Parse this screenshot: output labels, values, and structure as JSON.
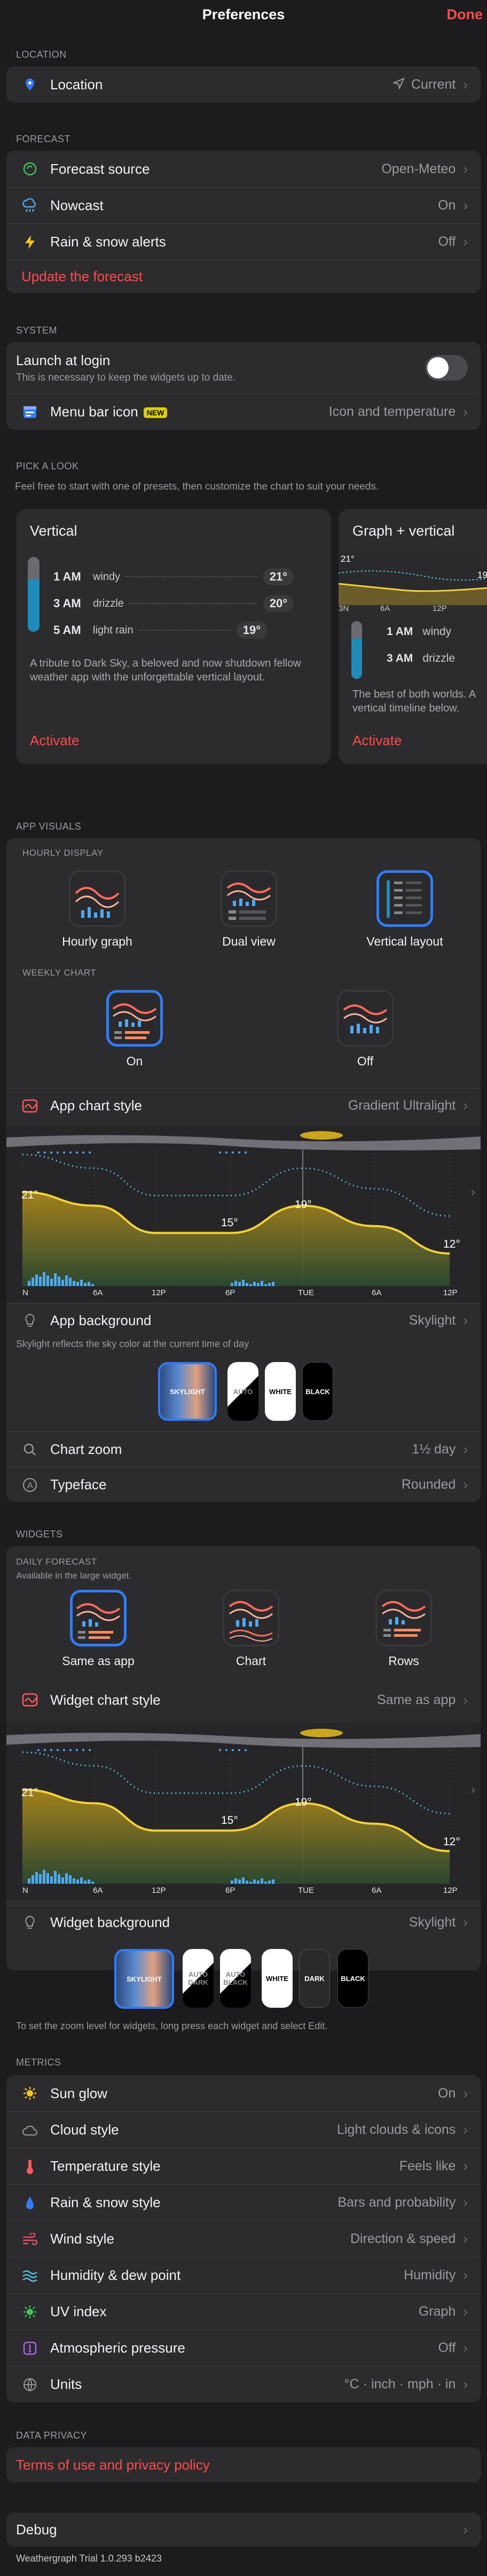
{
  "nav": {
    "title": "Preferences",
    "done": "Done"
  },
  "location": {
    "header": "LOCATION",
    "label": "Location",
    "value": "Current"
  },
  "forecast": {
    "header": "FORECAST",
    "source_label": "Forecast source",
    "source_value": "Open-Meteo",
    "nowcast_label": "Nowcast",
    "nowcast_value": "On",
    "alerts_label": "Rain & snow alerts",
    "alerts_value": "Off",
    "update_label": "Update the forecast"
  },
  "system": {
    "header": "SYSTEM",
    "launch_label": "Launch at login",
    "launch_sub": "This is necessary to keep the widgets up to date.",
    "menubar_label": "Menu bar icon",
    "menubar_badge": "NEW",
    "menubar_value": "Icon and temperature"
  },
  "look": {
    "header": "PICK A LOOK",
    "intro": "Feel free to start with one of presets, then customize the chart to suit your needs.",
    "vertical": {
      "title": "Vertical",
      "rows": [
        {
          "time": "1 AM",
          "cond": "windy",
          "temp": "21°"
        },
        {
          "time": "3 AM",
          "cond": "drizzle",
          "temp": "20°"
        },
        {
          "time": "5 AM",
          "cond": "light rain",
          "temp": "19°"
        }
      ],
      "desc": "A tribute to Dark Sky, a beloved and now shutdown fellow weather app with the unforgettable vertical layout.",
      "activate": "Activate"
    },
    "graph": {
      "title": "Graph + vertical",
      "temp1": "21°",
      "temp2": "19",
      "ticks": [
        "3N",
        "6A",
        "12P"
      ],
      "rows": [
        {
          "time": "1 AM",
          "cond": "windy"
        },
        {
          "time": "3 AM",
          "cond": "drizzle"
        }
      ],
      "desc": "The best of both worlds. A vertical timeline below.",
      "activate": "Activate"
    }
  },
  "visuals": {
    "header": "APP VISUALS",
    "hourly_header": "HOURLY DISPLAY",
    "hourly_options": [
      "Hourly graph",
      "Dual view",
      "Vertical layout"
    ],
    "weekly_header": "WEEKLY CHART",
    "weekly_options": [
      "On",
      "Off"
    ],
    "chart_style_label": "App chart style",
    "chart_style_value": "Gradient Ultralight",
    "bg_label": "App background",
    "bg_value": "Skylight",
    "bg_note": "Skylight reflects the sky color at the current time of day",
    "bg_options": [
      "SKYLIGHT",
      "AUTO",
      "WHITE",
      "BLACK"
    ],
    "zoom_label": "Chart zoom",
    "zoom_value": "1½ day",
    "typeface_label": "Typeface",
    "typeface_value": "Rounded"
  },
  "widgets": {
    "header": "WIDGETS",
    "daily_header": "DAILY FORECAST",
    "daily_note": "Available in the large widget.",
    "daily_options": [
      "Same as app",
      "Chart",
      "Rows"
    ],
    "chart_style_label": "Widget chart style",
    "chart_style_value": "Same as app",
    "bg_label": "Widget background",
    "bg_value": "Skylight",
    "bg_options": [
      "SKYLIGHT",
      "AUTO DARK",
      "AUTO BLACK",
      "WHITE",
      "DARK",
      "BLACK"
    ],
    "note": "To set the zoom level for widgets, long press each widget and select Edit."
  },
  "chart": {
    "labels": {
      "t1": "21°",
      "t2": "15°",
      "t3": "19°",
      "t4": "12°"
    },
    "xticks": [
      "N",
      "6A",
      "12P",
      "6P",
      "TUE",
      "6A",
      "12P"
    ]
  },
  "chart_data": {
    "type": "area",
    "x": [
      "N",
      "6A",
      "12P",
      "6P",
      "TUE",
      "6A",
      "12P"
    ],
    "series": [
      {
        "values": [
          21,
          19,
          15,
          15,
          19,
          16,
          12
        ]
      }
    ],
    "annotations": [
      "21°",
      "15°",
      "19°",
      "12°"
    ]
  },
  "metrics": {
    "header": "METRICS",
    "items": [
      {
        "label": "Sun glow",
        "value": "On"
      },
      {
        "label": "Cloud style",
        "value": "Light clouds & icons"
      },
      {
        "label": "Temperature style",
        "value": "Feels like"
      },
      {
        "label": "Rain & snow style",
        "value": "Bars and probability"
      },
      {
        "label": "Wind style",
        "value": "Direction & speed"
      },
      {
        "label": "Humidity & dew point",
        "value": "Humidity"
      },
      {
        "label": "UV index",
        "value": "Graph"
      },
      {
        "label": "Atmospheric pressure",
        "value": "Off"
      },
      {
        "label": "Units",
        "value": "°C · inch · mph · in"
      }
    ]
  },
  "privacy": {
    "header": "DATA PRIVACY",
    "link": "Terms of use and privacy policy"
  },
  "debug": {
    "label": "Debug"
  },
  "version": "Weathergraph Trial 1.0.293 b2423",
  "colors": {
    "accent": "#ff4a4a",
    "selection": "#2f7cf6",
    "temp_line": "#f2d13a",
    "dew_line": "#4fc3e0"
  }
}
